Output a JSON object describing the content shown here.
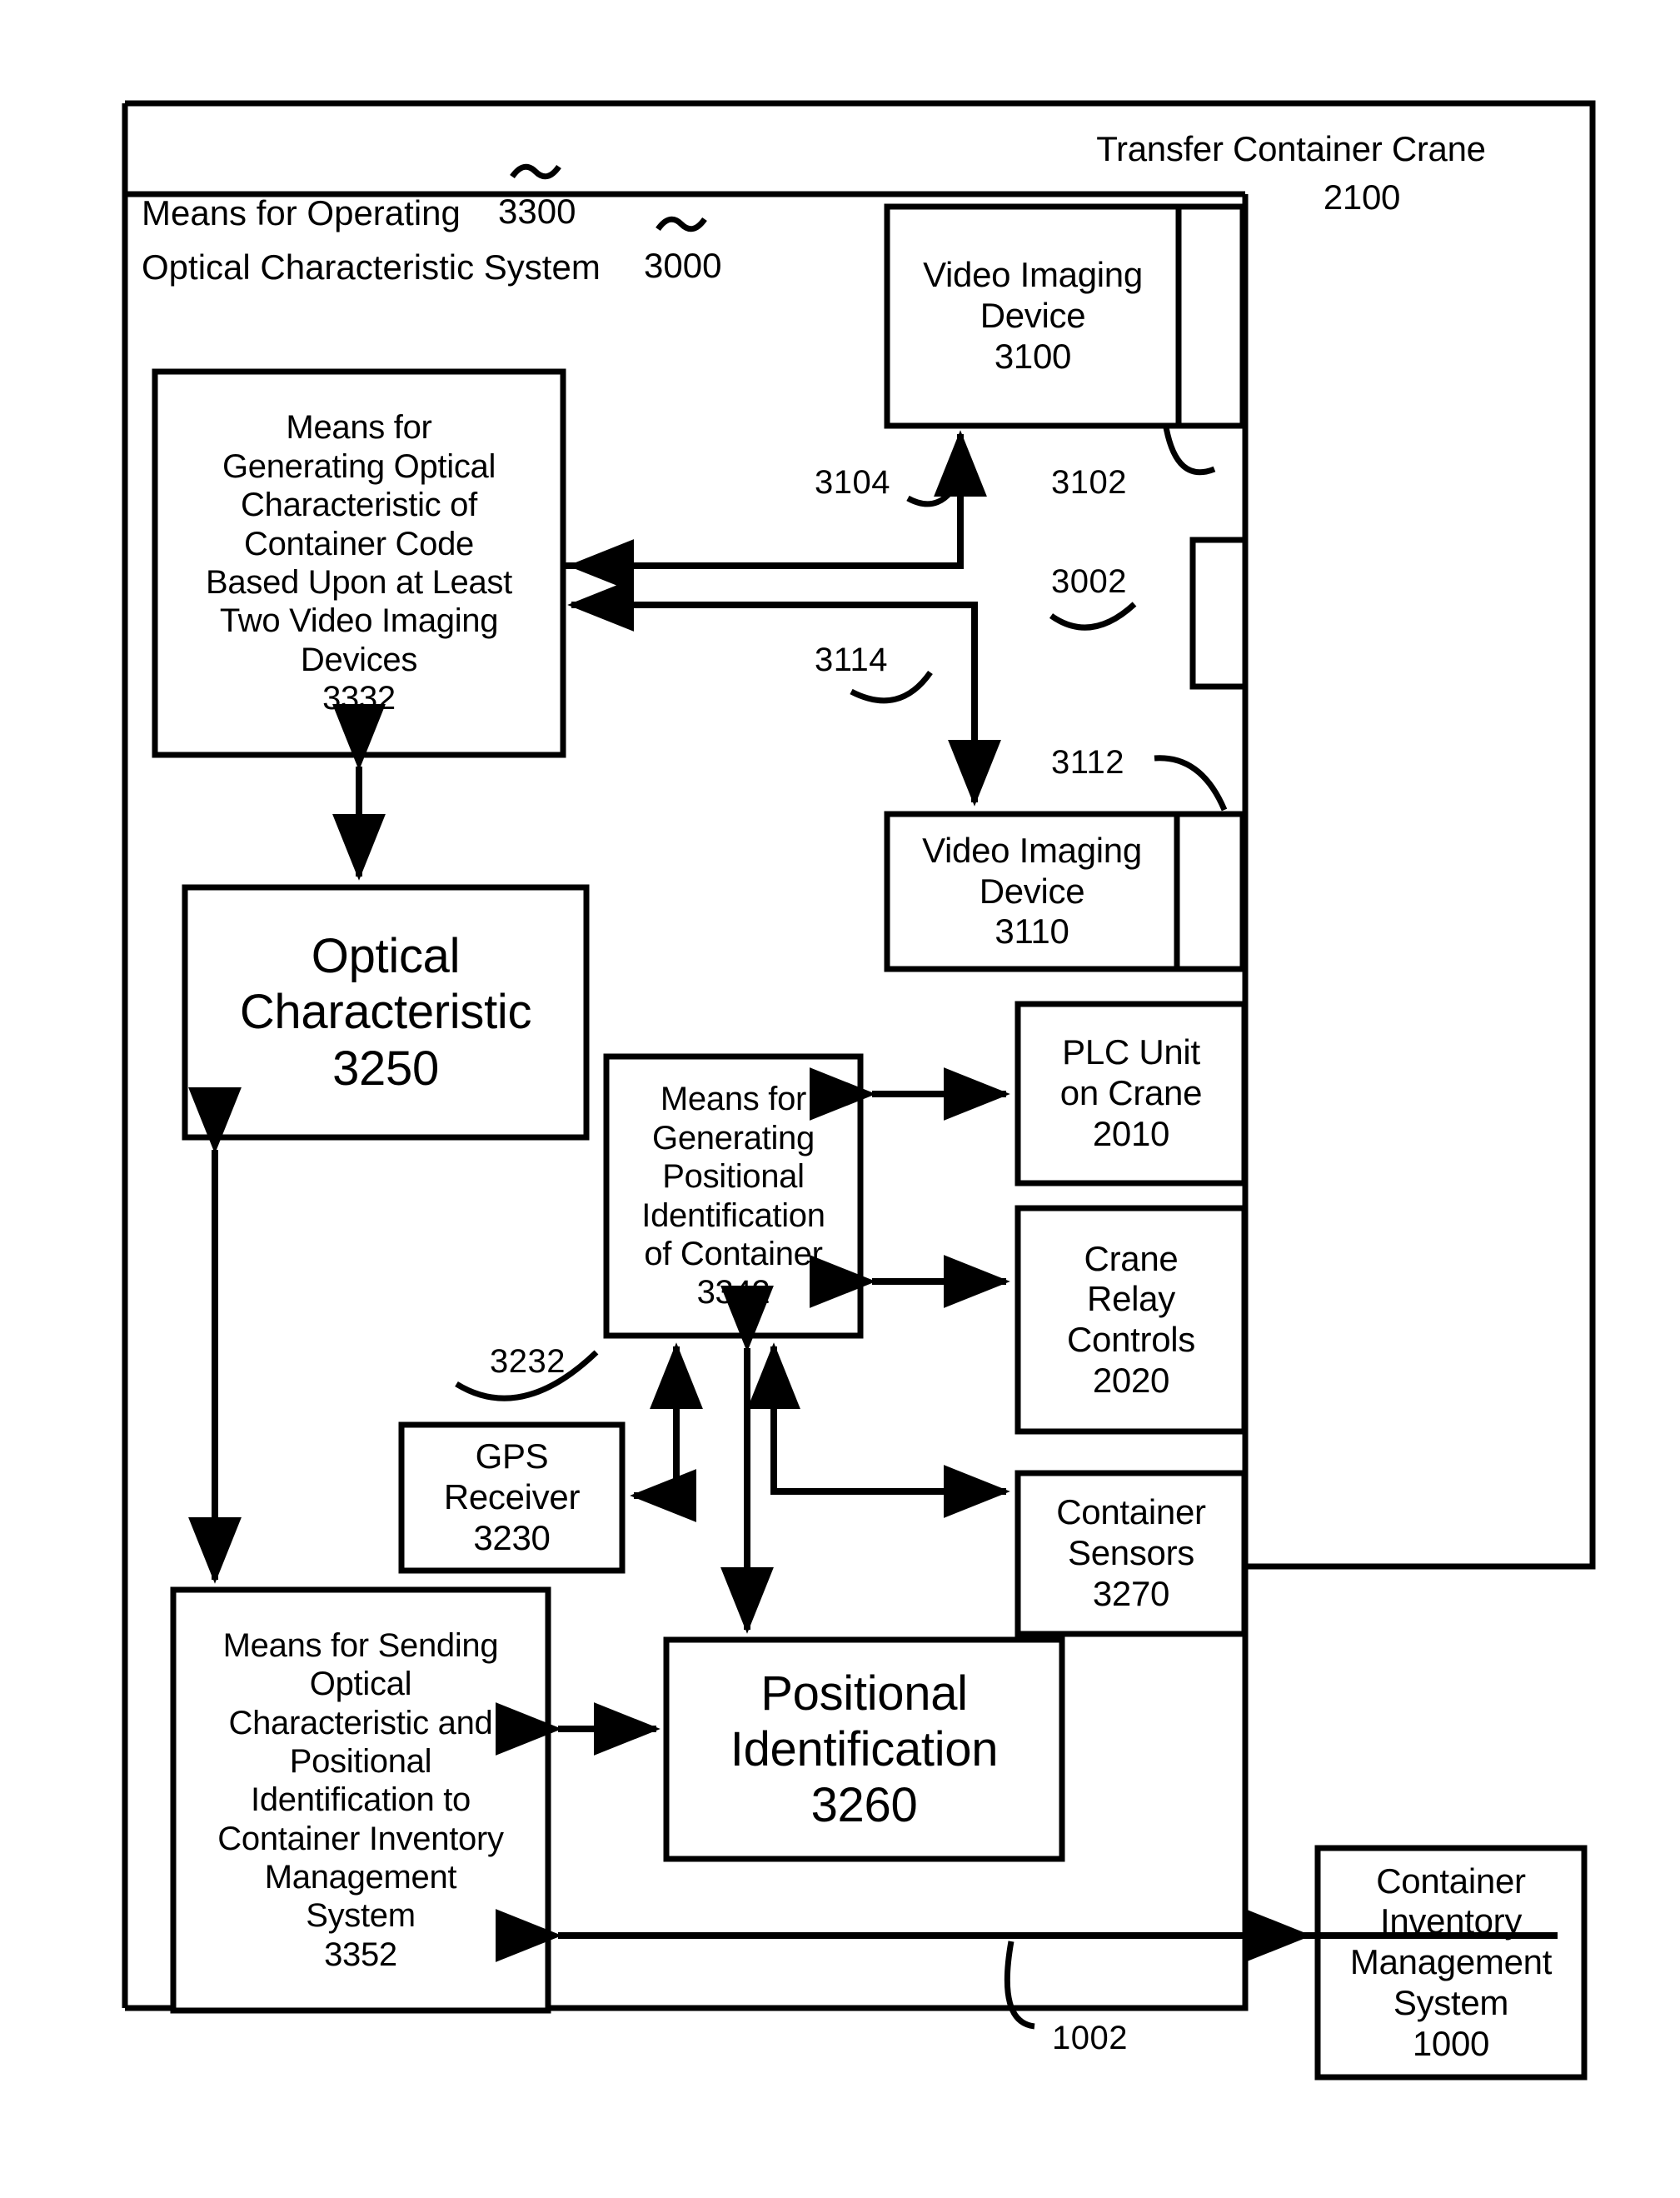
{
  "figure": {
    "outer_frame_label": "Transfer Container Crane",
    "outer_frame_ref": "2100",
    "inner_frame_line1": "Means for Operating",
    "inner_frame_line1_ref": "3300",
    "inner_frame_line2": "Optical Characteristic System",
    "inner_frame_line2_ref": "3000"
  },
  "boxes": {
    "generating_optical": {
      "text": "Means for\nGenerating Optical\nCharacteristic of\nContainer Code\nBased Upon at Least\nTwo Video Imaging\nDevices\n3332",
      "ref": "3332"
    },
    "video_device_top": {
      "text": "Video Imaging\nDevice\n3100",
      "ref": "3100"
    },
    "video_device_bottom": {
      "text": "Video Imaging\nDevice\n3110",
      "ref": "3110"
    },
    "optical_characteristic": {
      "text": "Optical\nCharacteristic\n3250",
      "ref": "3250"
    },
    "generating_positional": {
      "text": "Means for\nGenerating\nPositional\nIdentification\nof Container\n3342",
      "ref": "3342"
    },
    "plc_unit": {
      "text": "PLC Unit\non Crane\n2010",
      "ref": "2010"
    },
    "crane_relay": {
      "text": "Crane\nRelay\nControls\n2020",
      "ref": "2020"
    },
    "gps_receiver": {
      "text": "GPS\nReceiver\n3230",
      "ref": "3230"
    },
    "container_sensors": {
      "text": "Container\nSensors\n3270",
      "ref": "3270"
    },
    "means_sending": {
      "text": "Means for Sending\nOptical\nCharacteristic and\nPositional\nIdentification to\nContainer Inventory\nManagement\nSystem\n3352",
      "ref": "3352"
    },
    "positional_identification": {
      "text": "Positional\nIdentification\n3260",
      "ref": "3260"
    },
    "inventory_system": {
      "text": "Container\nInventory\nManagement\nSystem\n1000",
      "ref": "1000"
    }
  },
  "lead_refs": {
    "video_top_link": "3104",
    "video_top_port": "3102",
    "system_port": "3002",
    "video_bottom_link": "3114",
    "video_bottom_port": "3112",
    "gps_link": "3232",
    "inventory_link": "1002"
  }
}
